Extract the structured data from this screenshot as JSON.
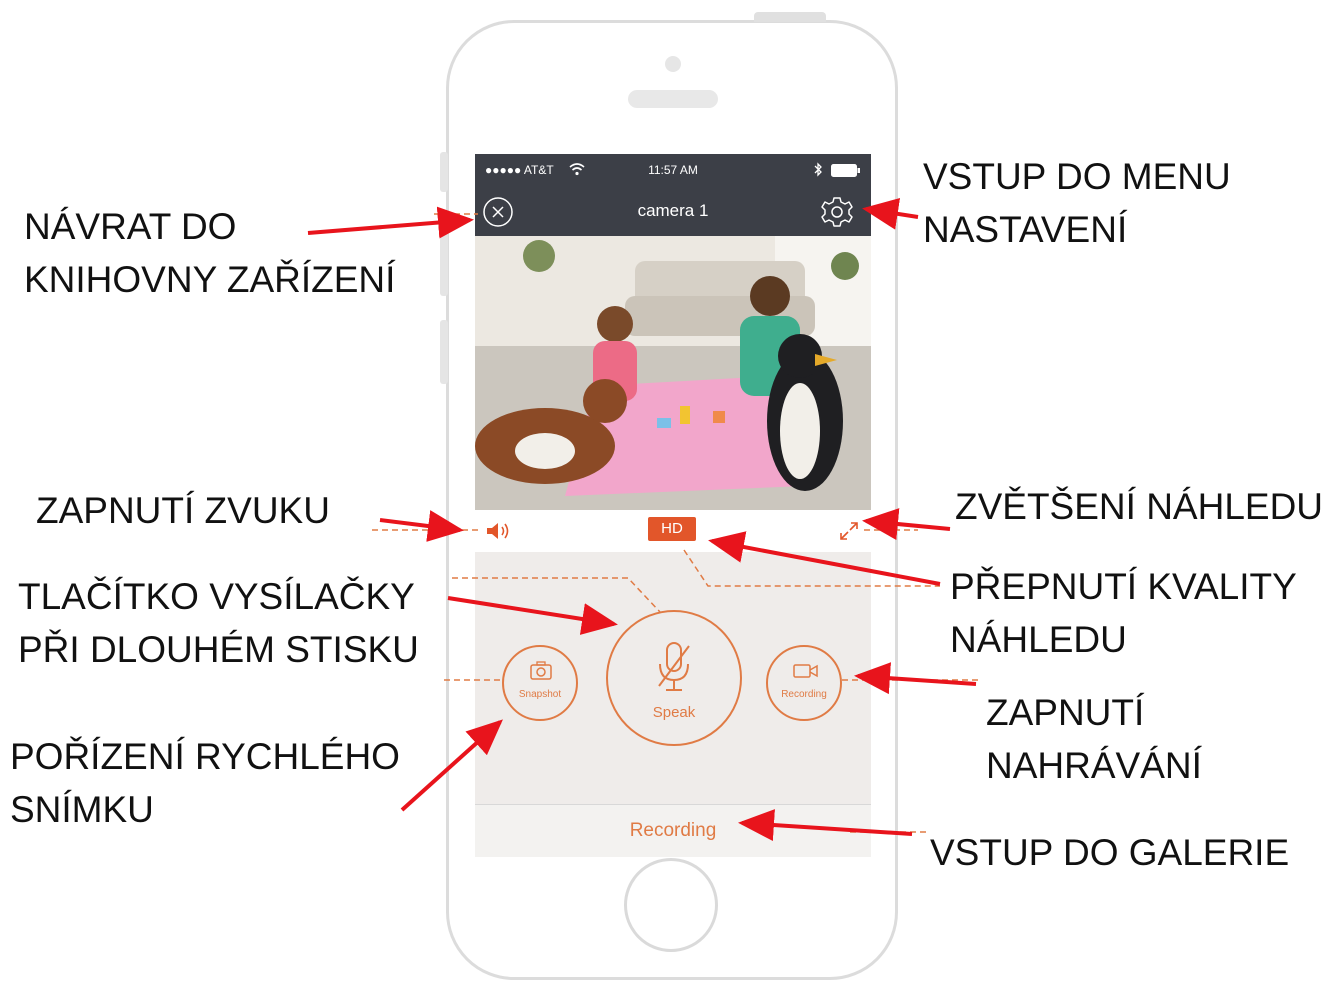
{
  "status_bar": {
    "carrier": "●●●●● AT&T",
    "time": "11:57 AM"
  },
  "nav_bar": {
    "title": "camera 1"
  },
  "controls": {
    "hd_label": "HD"
  },
  "buttons": {
    "snapshot": "Snapshot",
    "speak": "Speak",
    "recording": "Recording"
  },
  "gallery_bar": {
    "label": "Recording"
  },
  "annotations": {
    "back_line1": "NÁVRAT DO",
    "back_line2": "KNIHOVNY ZAŘÍZENÍ",
    "settings_line1": "VSTUP DO MENU",
    "settings_line2": "NASTAVENÍ",
    "sound": "ZAPNUTÍ ZVUKU",
    "fullscreen": "ZVĚTŠENÍ NÁHLEDU",
    "talk_line1": "TLAČÍTKO VYSÍLAČKY",
    "talk_line2": "PŘI DLOUHÉM STISKU",
    "quality_line1": "PŘEPNUTÍ KVALITY",
    "quality_line2": "NÁHLEDU",
    "record_line1": "ZAPNUTÍ",
    "record_line2": "NAHRÁVÁNÍ",
    "snapshot_line1": "POŘÍZENÍ RYCHLÉHO",
    "snapshot_line2": "SNÍMKU",
    "gallery": "VSTUP DO GALERIE"
  },
  "colors": {
    "accent": "#e07b45",
    "hd_badge": "#e2562a",
    "nav_bg": "#3c3f47",
    "arrow": "#e8141c"
  }
}
